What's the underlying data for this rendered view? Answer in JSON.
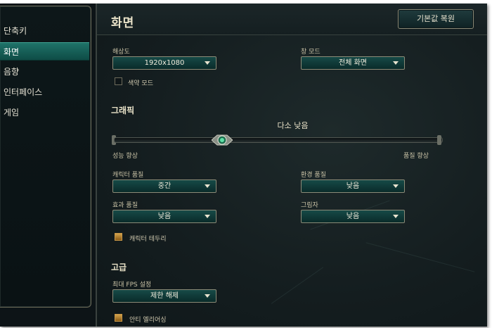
{
  "sidebar": {
    "items": [
      {
        "label": "단축키",
        "active": false
      },
      {
        "label": "화면",
        "active": true
      },
      {
        "label": "음향",
        "active": false
      },
      {
        "label": "인터페이스",
        "active": false
      },
      {
        "label": "게임",
        "active": false
      }
    ]
  },
  "header": {
    "title": "화면",
    "reset_label": "기본값 복원"
  },
  "display": {
    "resolution_label": "해상도",
    "resolution_value": "1920x1080",
    "window_mode_label": "창 모드",
    "window_mode_value": "전체 화면",
    "colorblind_label": "색약 모드",
    "colorblind_checked": false
  },
  "graphics": {
    "section_title": "그래픽",
    "quality_caption": "다소 낮음",
    "slider_min_label": "성능 향상",
    "slider_max_label": "품질 향상",
    "quality_level": 0.33,
    "character_quality_label": "캐릭터 품질",
    "character_quality_value": "중간",
    "environment_quality_label": "환경 품질",
    "environment_quality_value": "낮음",
    "effects_quality_label": "효과 품질",
    "effects_quality_value": "낮음",
    "shadows_label": "그림자",
    "shadows_value": "낮음",
    "character_outline_label": "캐릭터 테두리",
    "character_outline_checked": true
  },
  "advanced": {
    "section_title": "고급",
    "fps_label": "최대 FPS 설정",
    "fps_value": "제한 해제",
    "antialias_label": "안티 엘리어싱",
    "antialias_checked": true
  },
  "colors": {
    "accent_teal": "#1f7268",
    "text_cream": "#e9e2c8",
    "checkbox_gold": "#d2a24c"
  }
}
